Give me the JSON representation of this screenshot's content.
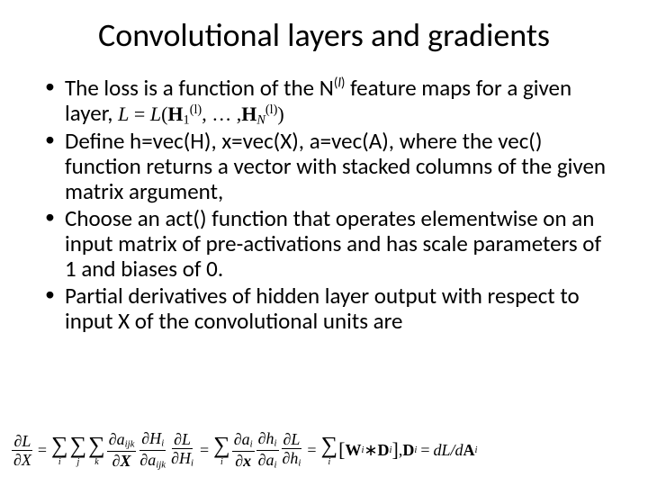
{
  "title": "Convolutional layers and gradients",
  "bullets": {
    "b1_pre": "The loss  is a function of the N",
    "b1_sup_l": "l",
    "b1_mid": " feature maps for a given layer,  ",
    "b2": "Define h=vec(H), x=vec(X), a=vec(A), where the vec() function returns a vector with stacked columns of the given matrix argument,",
    "b3": "Choose an act() function that operates elementwise on an input matrix of pre-activations and has scale parameters of 1 and biases of 0.",
    "b4": "Partial derivatives of hidden layer output with respect to input X of the convolutional units are"
  },
  "inline_eq": {
    "L": "L",
    "eq": " = ",
    "Lfn": "L",
    "open": "(",
    "H": "H",
    "sub1": "1",
    "supl": "(l)",
    "dots": ", … ,",
    "subN": "N",
    "sublparen": "(l)",
    "close": ")"
  },
  "bottom": {
    "dL": "∂L",
    "dX": "∂X",
    "da_ijk": "∂a",
    "sub_ijk": "ijk",
    "dH_i": "∂H",
    "sub_i": "i",
    "da_i": "∂a",
    "dh_i": "∂h",
    "dx": "∂x",
    "W": "W",
    "D": "D",
    "star": " ∗ ",
    "comma": ", ",
    "dLdA": "dL/d",
    "A": "A",
    "eq": "="
  }
}
